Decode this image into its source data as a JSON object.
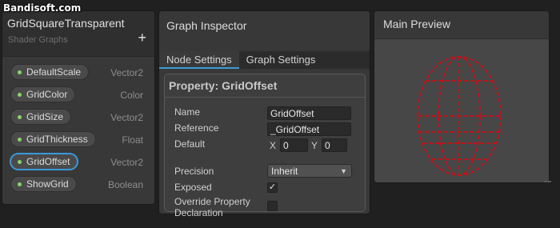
{
  "watermark": "Bandisoft.com",
  "blackboard": {
    "title": "GridSquareTransparent",
    "subtitle": "Shader Graphs",
    "add_label": "+",
    "properties": [
      {
        "name": "DefaultScale",
        "type": "Vector2"
      },
      {
        "name": "GridColor",
        "type": "Color"
      },
      {
        "name": "GridSize",
        "type": "Vector2"
      },
      {
        "name": "GridThickness",
        "type": "Float"
      },
      {
        "name": "GridOffset",
        "type": "Vector2",
        "selected": true
      },
      {
        "name": "ShowGrid",
        "type": "Boolean"
      }
    ]
  },
  "inspector": {
    "title": "Graph Inspector",
    "tabs": [
      "Node Settings",
      "Graph Settings"
    ],
    "active_tab": "Node Settings",
    "property": {
      "header": "Property: GridOffset",
      "name_label": "Name",
      "name_value": "GridOffset",
      "reference_label": "Reference",
      "reference_value": "_GridOffset",
      "default_label": "Default",
      "default_x_label": "X",
      "default_x": "0",
      "default_y_label": "Y",
      "default_y": "0",
      "precision_label": "Precision",
      "precision_value": "Inherit",
      "exposed_label": "Exposed",
      "exposed_checked": "✓",
      "override_label_1": "Override Property",
      "override_label_2": "Declaration"
    }
  },
  "preview": {
    "title": "Main Preview",
    "grid_color": "#c0141c"
  },
  "colors": {
    "accent": "#3a9ad9",
    "property_dot": "#8bd36a"
  }
}
